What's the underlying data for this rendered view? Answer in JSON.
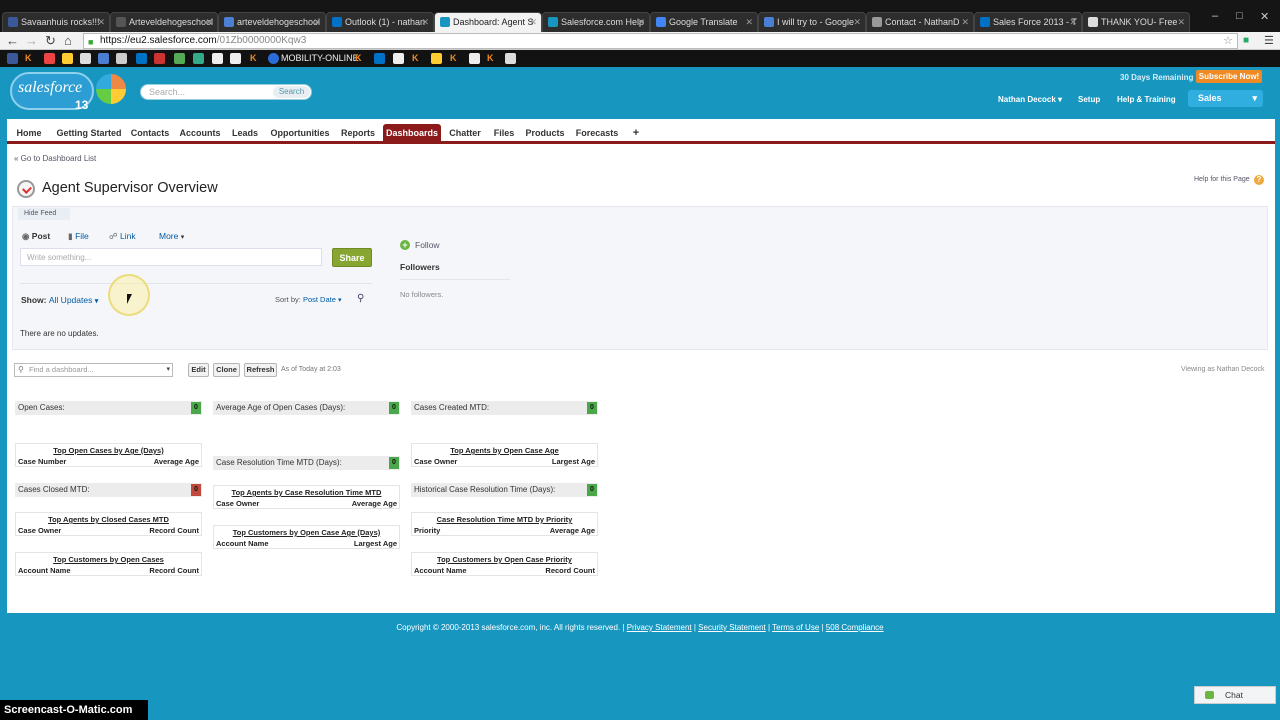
{
  "browser": {
    "tabs": [
      {
        "label": "Savaanhuis rocks!!!",
        "color": "#3b5998"
      },
      {
        "label": "Arteveldehogeschool",
        "color": "#555555"
      },
      {
        "label": "arteveldehogeschool",
        "color": "#4a7fd4"
      },
      {
        "label": "Outlook (1) - nathan",
        "color": "#0072c6"
      },
      {
        "label": "Dashboard: Agent S",
        "color": "#1797c0"
      },
      {
        "label": "Salesforce.com Help",
        "color": "#1797c0"
      },
      {
        "label": "Google Translate",
        "color": "#4285f4"
      },
      {
        "label": "I will try to - Google",
        "color": "#4a7fd4"
      },
      {
        "label": "Contact - NathanD",
        "color": "#999999"
      },
      {
        "label": "Sales Force 2013 - T",
        "color": "#0072c6"
      },
      {
        "label": "THANK YOU- Free",
        "color": "#dddddd"
      }
    ],
    "url_host": "https://eu2.salesforce.com",
    "url_path": "/01Zb0000000Kqw3",
    "bookmark_label": "MOBILITY-ONLINE"
  },
  "header": {
    "logo_word": "salesforce",
    "logo_num": "13",
    "search_placeholder": "Search...",
    "search_button": "Search",
    "trial": "30 Days Remaining",
    "subscribe": "Subscribe Now!",
    "user": "Nathan Decock",
    "setup": "Setup",
    "help_training": "Help & Training",
    "app": "Sales"
  },
  "nav": {
    "tabs": [
      "Home",
      "Getting Started",
      "Contacts",
      "Accounts",
      "Leads",
      "Opportunities",
      "Reports",
      "Dashboards",
      "Chatter",
      "Files",
      "Products",
      "Forecasts",
      "+"
    ],
    "active": "Dashboards"
  },
  "page": {
    "back_link": "« Go to Dashboard List",
    "title": "Agent Supervisor Overview",
    "help": "Help for this Page"
  },
  "feed": {
    "hide": "Hide Feed",
    "post": "Post",
    "file": "File",
    "link": "Link",
    "more": "More",
    "write_placeholder": "Write something...",
    "share": "Share",
    "show_label": "Show:",
    "show_value": "All Updates",
    "sort_label": "Sort by:",
    "sort_value": "Post Date",
    "no_updates": "There are no updates.",
    "follow": "Follow",
    "followers": "Followers",
    "no_followers": "No followers."
  },
  "toolbar": {
    "find_placeholder": "Find a dashboard...",
    "edit": "Edit",
    "clone": "Clone",
    "refresh": "Refresh",
    "as_of": "As of Today at 2:03",
    "viewing": "Viewing as Nathan Decock"
  },
  "components": {
    "col1": {
      "open_cases": {
        "label": "Open Cases:",
        "value": "0"
      },
      "top_open_age": {
        "title": "Top Open Cases by Age (Days)",
        "c1": "Case Number",
        "c2": "Average Age"
      },
      "closed_mtd": {
        "label": "Cases Closed MTD:",
        "value": "0"
      },
      "top_agents_closed": {
        "title": "Top Agents by Closed Cases MTD",
        "c1": "Case Owner",
        "c2": "Record Count"
      },
      "top_customers_open": {
        "title": "Top Customers by Open Cases",
        "c1": "Account Name",
        "c2": "Record Count"
      }
    },
    "col2": {
      "avg_age": {
        "label": "Average Age of Open Cases (Days):",
        "value": "0"
      },
      "resolution_time": {
        "label": "Case Resolution Time MTD (Days):",
        "value": "0"
      },
      "top_agents_resolution": {
        "title": "Top Agents by Case Resolution Time MTD",
        "c1": "Case Owner",
        "c2": "Average Age"
      },
      "top_customers_age": {
        "title": "Top Customers by Open Case Age (Days)",
        "c1": "Account Name",
        "c2": "Largest Age"
      }
    },
    "col3": {
      "created_mtd": {
        "label": "Cases Created MTD:",
        "value": "0"
      },
      "top_agents_age": {
        "title": "Top Agents by Open Case Age",
        "c1": "Case Owner",
        "c2": "Largest Age"
      },
      "historical": {
        "label": "Historical Case Resolution Time (Days):",
        "value": "0"
      },
      "resolution_priority": {
        "title": "Case Resolution Time MTD by Priority",
        "c1": "Priority",
        "c2": "Average Age"
      },
      "top_customers_priority": {
        "title": "Top Customers by Open Case Priority",
        "c1": "Account Name",
        "c2": "Record Count"
      }
    }
  },
  "footer": {
    "copyright": "Copyright © 2000-2013 salesforce.com, inc. All rights reserved.",
    "links": [
      "Privacy Statement",
      "Security Statement",
      "Terms of Use",
      "508 Compliance"
    ]
  },
  "chat": "Chat",
  "watermark": "Screencast-O-Matic.com",
  "colors": {
    "brand": "#1797c0",
    "active_tab": "#8b1b1b",
    "share": "#87a531",
    "metric_ok": "#4aa84a",
    "metric_bad": "#c0493e"
  }
}
